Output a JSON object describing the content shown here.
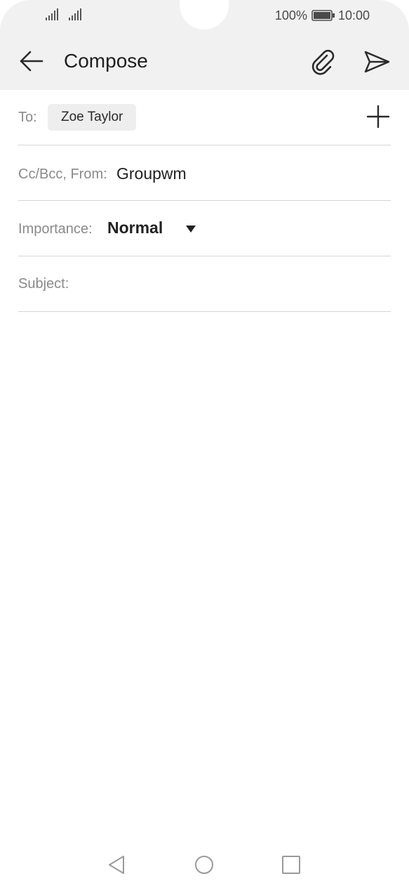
{
  "status_bar": {
    "signal_icons": [
      "signal-strength-icon",
      "signal-strength-icon"
    ],
    "battery_percent": "100%",
    "battery_icon": "battery-full-icon",
    "time": "10:00"
  },
  "app_bar": {
    "back_icon": "arrow-left-icon",
    "title": "Compose",
    "attach_icon": "paperclip-icon",
    "send_icon": "send-icon"
  },
  "compose": {
    "to": {
      "label": "To:",
      "recipients": [
        "Zoe Taylor"
      ],
      "add_icon": "plus-icon"
    },
    "cc_bcc_from": {
      "label": "Cc/Bcc, From:",
      "value": "Groupwm"
    },
    "importance": {
      "label": "Importance:",
      "selected": "Normal",
      "dropdown_icon": "triangle-down-icon"
    },
    "subject": {
      "label": "Subject:",
      "value": ""
    }
  },
  "nav_bar": {
    "back_icon": "triangle-back-icon",
    "home_icon": "circle-home-icon",
    "recents_icon": "square-recents-icon"
  },
  "colors": {
    "chrome_background": "#f1f1f1",
    "text_primary": "#212121",
    "text_label": "#8a8a8a",
    "divider": "#d6d6d6",
    "chip_background": "#eeeeee"
  }
}
